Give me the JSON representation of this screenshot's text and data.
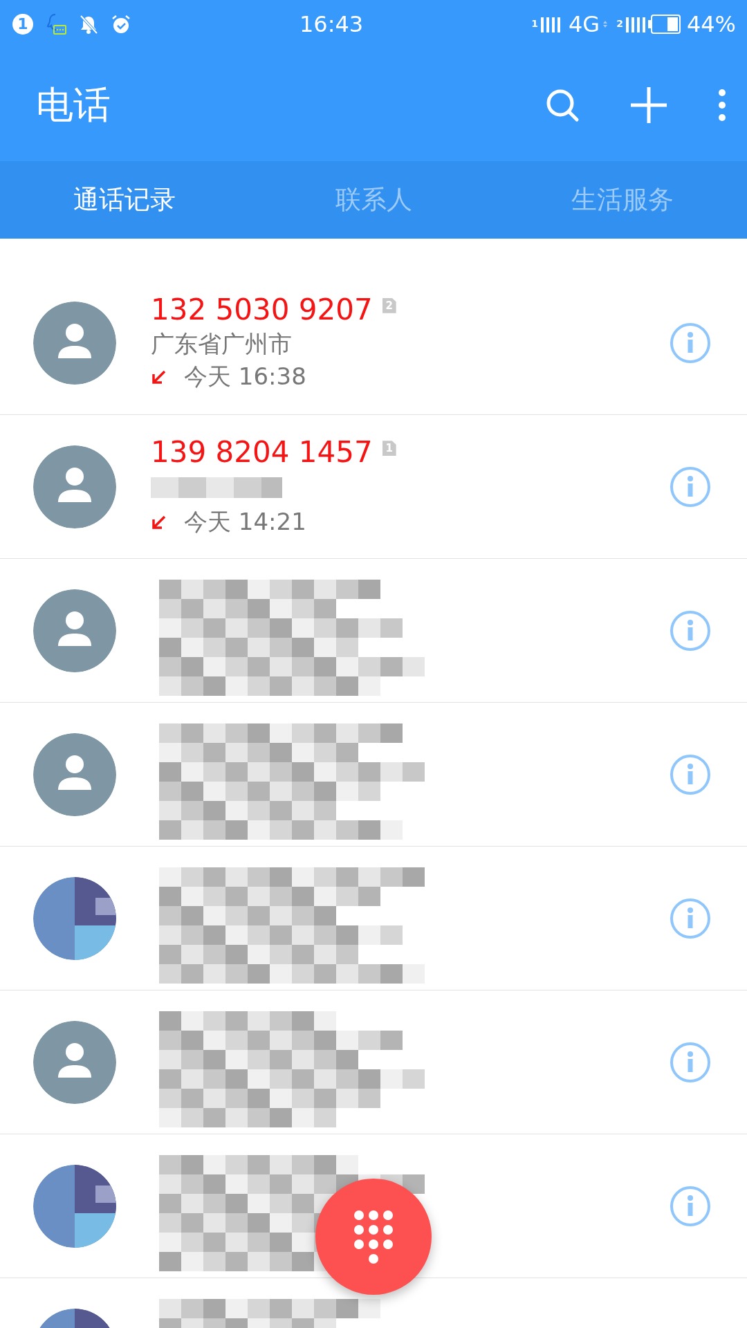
{
  "status_bar": {
    "notification_count": "1",
    "time": "16:43",
    "sim1_label": "1",
    "network": "4G",
    "sim2_label": "2",
    "battery": "44%"
  },
  "toolbar": {
    "title": "电话"
  },
  "tabs": [
    {
      "label": "通话记录",
      "selected": true
    },
    {
      "label": "联系人",
      "selected": false
    },
    {
      "label": "生活服务",
      "selected": false
    }
  ],
  "calls": [
    {
      "avatar": {
        "kind": "person"
      },
      "redacted": false,
      "number": "132 5030 9207",
      "sim": "2",
      "location": "广东省广州市",
      "missed": true,
      "time": "今天 16:38"
    },
    {
      "avatar": {
        "kind": "person"
      },
      "redacted": false,
      "number": "139 8204 1457",
      "sim": "1",
      "missed": true,
      "time": "今天 14:21",
      "location_redacted": true
    },
    {
      "avatar": {
        "kind": "person"
      },
      "redacted": true
    },
    {
      "avatar": {
        "kind": "person"
      },
      "redacted": true
    },
    {
      "redacted": true
    },
    {
      "avatar": {
        "kind": "person"
      },
      "redacted": true
    },
    {
      "redacted": true
    },
    {
      "redacted": true
    }
  ]
}
